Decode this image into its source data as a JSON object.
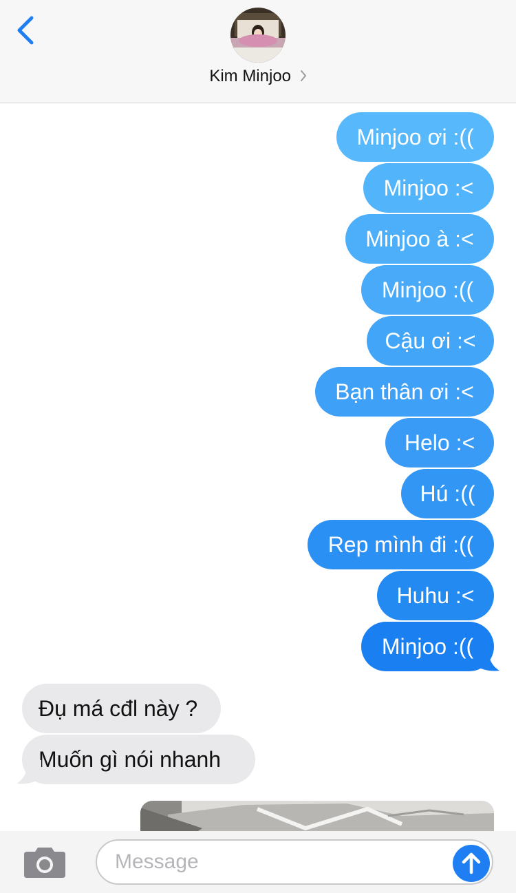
{
  "header": {
    "contact_name": "Kim Minjoo"
  },
  "messages": {
    "sent": [
      "Minjoo ơi :((",
      "Minjoo :<",
      "Minjoo à :<",
      "Minjoo :((",
      "Cậu ơi :<",
      "Bạn thân ơi :<",
      "Helo :<",
      "Hú :((",
      "Rep mình đi :((",
      "Huhu :<",
      "Minjoo :(("
    ],
    "received": [
      "Đụ má cđl này ?",
      "Muốn gì nói nhanh"
    ]
  },
  "input": {
    "placeholder": "Message"
  },
  "colors": {
    "sent_gradient_top": "#57b9fb",
    "sent_gradient_bottom": "#1a7ff1",
    "received_bubble": "#e9e9eb",
    "accent": "#1e7ef2"
  },
  "icons": {
    "back": "chevron-left-icon",
    "name_chevron": "chevron-right-icon",
    "camera": "camera-icon",
    "send": "arrow-up-icon"
  }
}
